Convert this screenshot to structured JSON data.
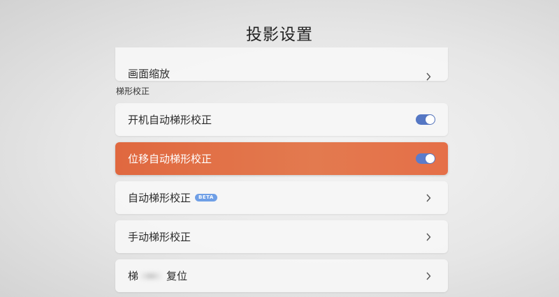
{
  "page": {
    "title": "投影设置"
  },
  "items_top": {
    "label": "画面缩放"
  },
  "section": {
    "label": "梯形校正"
  },
  "rows": [
    {
      "label": "开机自动梯形校正",
      "control": "toggle",
      "state": "on"
    },
    {
      "label": "位移自动梯形校正",
      "control": "toggle",
      "state": "on",
      "focused": true
    },
    {
      "label": "自动梯形校正",
      "badge": "BETA",
      "control": "chevron"
    },
    {
      "label": "手动梯形校正",
      "control": "chevron"
    },
    {
      "label_start": "梯",
      "label_end": "复位",
      "control": "chevron"
    }
  ],
  "colors": {
    "focus_bg": "#e37a4f",
    "toggle_on": "#5577c4",
    "badge_bg": "#6f9fe6"
  },
  "icons": {
    "chevron": "chevron-right-icon",
    "toggle": "toggle-switch"
  }
}
